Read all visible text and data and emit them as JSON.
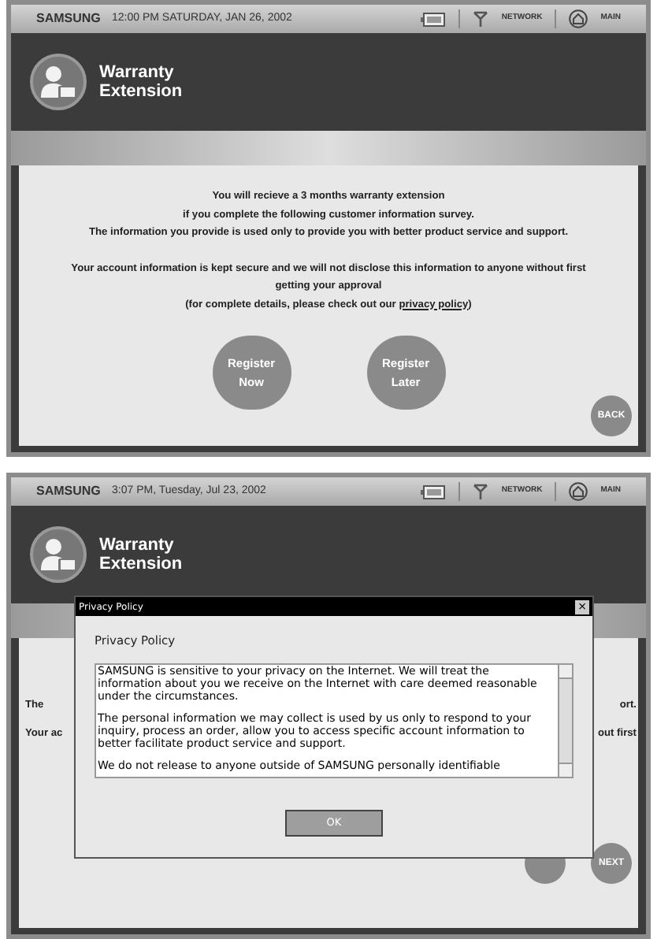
{
  "screens": [
    {
      "kind": "intro",
      "status_bar": {
        "brand": "SAMSUNG",
        "datetime": "12:00 PM SATURDAY, JAN 26, 2002",
        "network": "NETWORK",
        "main": "MAIN"
      },
      "header": {
        "title": [
          "Warranty",
          "Extension"
        ]
      },
      "message": {
        "lines": [
          "You will recieve a 3 months warranty extension",
          "if you complete the following customer information survey.",
          "The information you provide is used only to provide you with better product service and support."
        ],
        "notice": "Your account information is kept secure and we will not disclose this information to anyone without first getting your approval",
        "details_before": "(for complete details, please check out our ",
        "details_link": "privacy policy",
        "details_after": ")"
      },
      "round_buttons": [
        {
          "label": "Register Now"
        },
        {
          "label": "Register Later"
        }
      ],
      "corner_buttons": [
        {
          "kind": "labeled",
          "label": "BACK"
        }
      ]
    },
    {
      "kind": "dialog",
      "status_bar": {
        "brand": "SAMSUNG",
        "datetime": "3:07 PM, Tuesday, Jul 23, 2002",
        "network": "NETWORK",
        "main": "MAIN"
      },
      "header": {
        "title": [
          "Warranty",
          "Extension"
        ]
      },
      "background_fragments": [
        {
          "left": "The",
          "right": "ort."
        },
        {
          "left": "Your ac",
          "right": "out first"
        }
      ],
      "corner_buttons": [
        {
          "kind": "hidden"
        },
        {
          "kind": "labeled",
          "label": "NEXT"
        }
      ],
      "dialog": {
        "title": "Privacy Policy",
        "close": "×",
        "heading": "Privacy Policy",
        "paragraphs": [
          "SAMSUNG is sensitive to your privacy on the Internet. We will treat the information about you we receive on the Internet with care deemed reasonable under the circumstances.",
          "The personal information we may collect is used by us only to respond to your inquiry, process an order, allow you to access specific account information to better facilitate product service and support.",
          "We do not release to anyone outside of SAMSUNG personally identifiable"
        ],
        "ok": "OK"
      }
    }
  ]
}
